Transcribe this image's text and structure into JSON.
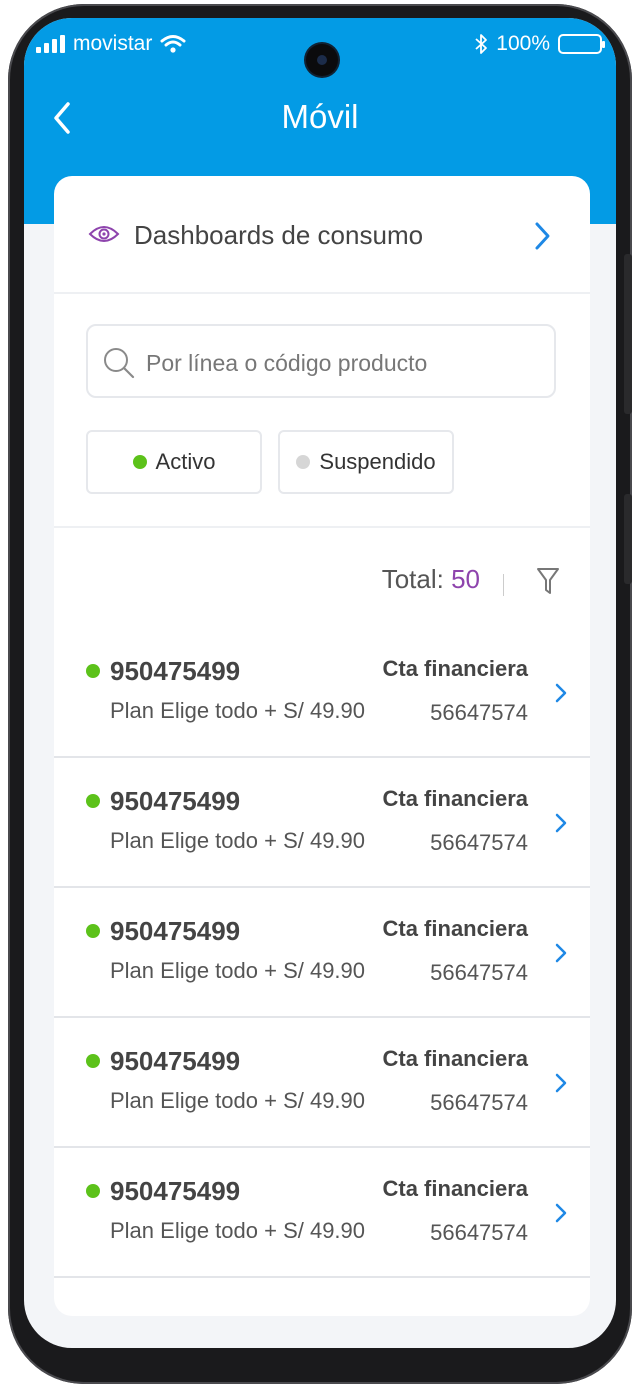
{
  "status_bar": {
    "carrier": "movistar",
    "battery": "100%"
  },
  "header": {
    "title": "Móvil"
  },
  "dashboard": {
    "label": "Dashboards de consumo"
  },
  "search": {
    "placeholder": "Por línea o código producto"
  },
  "filters": [
    {
      "label": "Activo",
      "color": "#5cc21a"
    },
    {
      "label": "Suspendido",
      "color": "#d6d6d6"
    }
  ],
  "summary": {
    "total_label": "Total:",
    "total_value": "50"
  },
  "lines": [
    {
      "number": "950475499",
      "plan": "Plan Elige todo + S/ 49.90",
      "account_label": "Cta financiera",
      "account": "56647574"
    },
    {
      "number": "950475499",
      "plan": "Plan Elige todo + S/ 49.90",
      "account_label": "Cta financiera",
      "account": "56647574"
    },
    {
      "number": "950475499",
      "plan": "Plan Elige todo + S/ 49.90",
      "account_label": "Cta financiera",
      "account": "56647574"
    },
    {
      "number": "950475499",
      "plan": "Plan Elige todo + S/ 49.90",
      "account_label": "Cta financiera",
      "account": "56647574"
    },
    {
      "number": "950475499",
      "plan": "Plan Elige todo + S/ 49.90",
      "account_label": "Cta financiera",
      "account": "56647574"
    }
  ],
  "colors": {
    "brand": "#039be5",
    "active": "#5cc21a",
    "accent": "#8e44ad",
    "chevron": "#1e88e5"
  }
}
